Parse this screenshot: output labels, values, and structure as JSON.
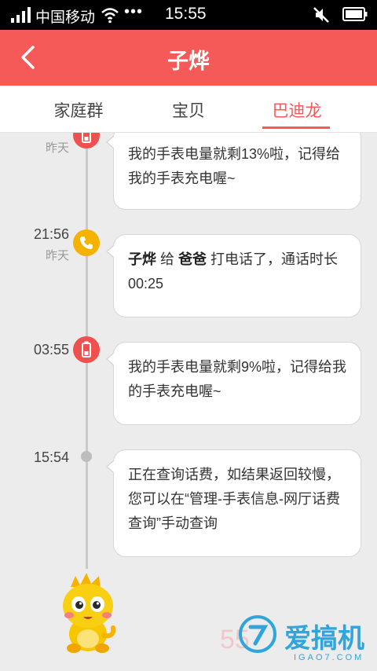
{
  "status_bar": {
    "carrier": "中国移动",
    "more": "•••",
    "time": "15:55"
  },
  "header": {
    "title": "子烨"
  },
  "tabs": [
    {
      "label": "家庭群",
      "active": false
    },
    {
      "label": "宝贝",
      "active": false
    },
    {
      "label": "巴迪龙",
      "active": true
    }
  ],
  "timeline": [
    {
      "time": "",
      "day": "昨天",
      "icon": "battery-icon",
      "text": "我的手表电量就剩13%啦，记得给我的手表充电喔~"
    },
    {
      "time": "21:56",
      "day": "昨天",
      "icon": "phone-icon",
      "caller": "子烨",
      "joiner": "给",
      "callee": "爸爸",
      "text": "打电话了，通话时长 00:25"
    },
    {
      "time": "03:55",
      "day": "",
      "icon": "battery-icon",
      "text": "我的手表电量就剩9%啦，记得给我的手表充电喔~"
    },
    {
      "time": "15:54",
      "day": "",
      "icon": "dot-icon",
      "text": "正在查询话费，如结果返回较慢，您可以在“管理-手表信息-网厅话费查询”手动查询"
    }
  ],
  "watermark": {
    "brand": "爱搞机",
    "domain": "IGAO7.COM",
    "faded": "55"
  },
  "colors": {
    "accent": "#f55a58",
    "phone": "#f5b300",
    "battery": "#f0504e"
  }
}
